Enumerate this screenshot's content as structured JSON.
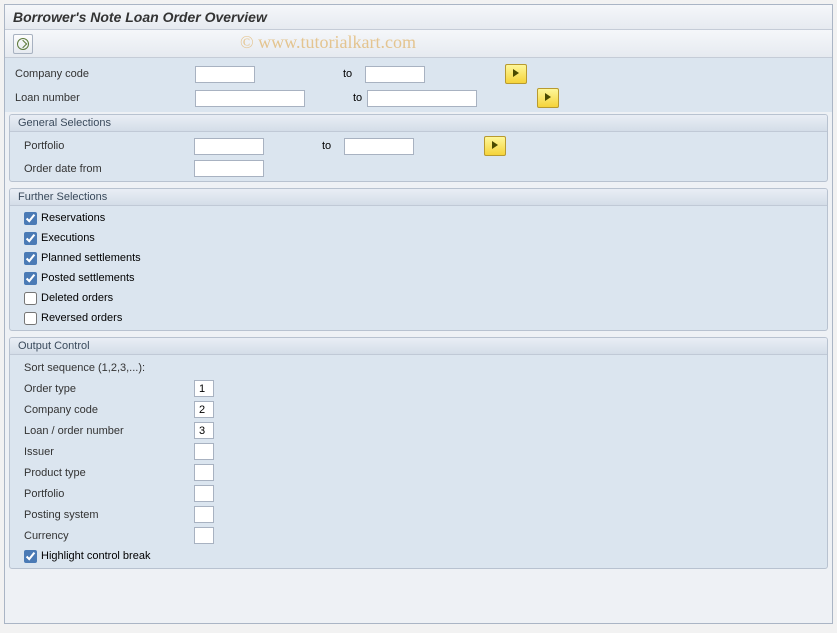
{
  "title": "Borrower's Note Loan Order Overview",
  "watermark": "© www.tutorialkart.com",
  "fields": {
    "company_code_label": "Company code",
    "company_code_from": "",
    "company_code_to_label": "to",
    "company_code_to": "",
    "loan_number_label": "Loan number",
    "loan_number_from": "",
    "loan_number_to_label": "to",
    "loan_number_to": ""
  },
  "general": {
    "header": "General Selections",
    "portfolio_label": "Portfolio",
    "portfolio_from": "",
    "portfolio_to_label": "to",
    "portfolio_to": "",
    "order_date_from_label": "Order date from",
    "order_date_from": ""
  },
  "further": {
    "header": "Further Selections",
    "reservations_label": "Reservations",
    "reservations_checked": true,
    "executions_label": "Executions",
    "executions_checked": true,
    "planned_settlements_label": "Planned settlements",
    "planned_settlements_checked": true,
    "posted_settlements_label": "Posted settlements",
    "posted_settlements_checked": true,
    "deleted_orders_label": "Deleted orders",
    "deleted_orders_checked": false,
    "reversed_orders_label": "Reversed orders",
    "reversed_orders_checked": false
  },
  "output": {
    "header": "Output Control",
    "sort_sequence_label": "Sort sequence (1,2,3,...):",
    "order_type_label": "Order type",
    "order_type_val": "1",
    "company_code_label": "Company code",
    "company_code_val": "2",
    "loan_order_number_label": "Loan / order number",
    "loan_order_number_val": "3",
    "issuer_label": "Issuer",
    "issuer_val": "",
    "product_type_label": "Product type",
    "product_type_val": "",
    "portfolio_label": "Portfolio",
    "portfolio_val": "",
    "posting_system_label": "Posting system",
    "posting_system_val": "",
    "currency_label": "Currency",
    "currency_val": "",
    "highlight_label": "Highlight control break",
    "highlight_checked": true
  }
}
